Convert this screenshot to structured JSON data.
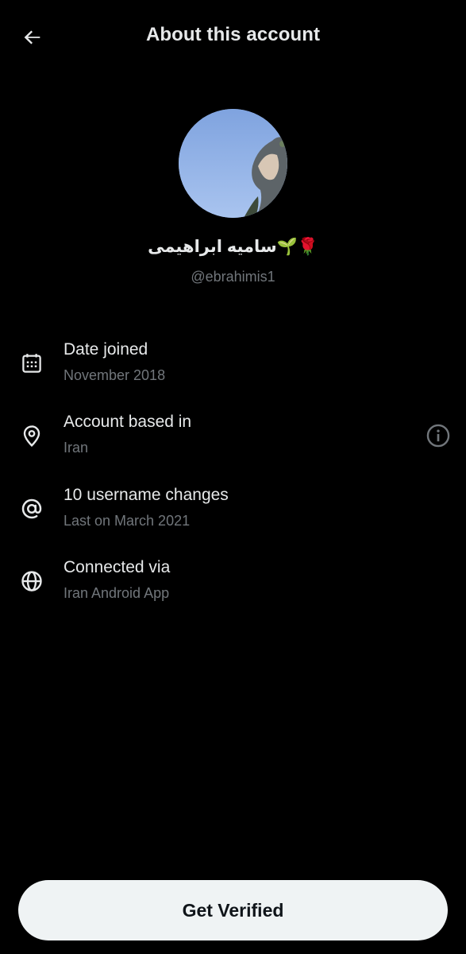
{
  "header": {
    "title": "About this account",
    "back_icon": "arrow-left-icon"
  },
  "profile": {
    "display_name": "سامیه ابراهیمی🌱🌹",
    "handle": "@ebrahimis1"
  },
  "rows": [
    {
      "icon": "calendar-icon",
      "label": "Date joined",
      "value": "November 2018"
    },
    {
      "icon": "location-pin-icon",
      "label": "Account based in",
      "value": "Iran",
      "action_icon": "info-icon"
    },
    {
      "icon": "at-sign-icon",
      "label": "10 username changes",
      "value": "Last on March 2021"
    },
    {
      "icon": "globe-icon",
      "label": "Connected via",
      "value": "Iran Android App"
    }
  ],
  "cta": {
    "label": "Get Verified"
  },
  "colors": {
    "background": "#000000",
    "primary_text": "#e7e9ea",
    "secondary_text": "#71767b",
    "button_bg": "#eff3f4",
    "button_text": "#0f1419"
  }
}
